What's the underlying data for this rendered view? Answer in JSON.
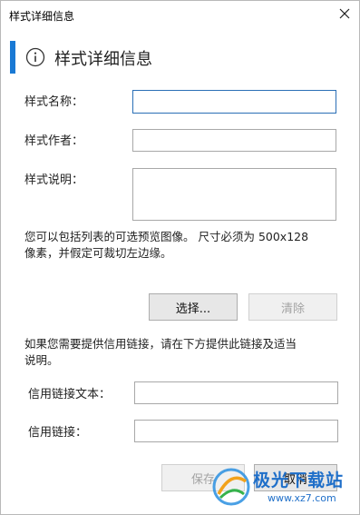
{
  "window": {
    "title": "样式详细信息"
  },
  "header": {
    "title": "样式详细信息",
    "icon": "info-icon",
    "accent_color": "#1979d4"
  },
  "form": {
    "style_name_label": "样式名称：",
    "style_name_value": "",
    "style_author_label": "样式作者：",
    "style_author_value": "",
    "style_description_label": "样式说明：",
    "style_description_value": ""
  },
  "preview": {
    "note_line1": "您可以包括列表的可选预览图像。 尺寸必须为 500x128",
    "note_line2": "像素，并假定可裁切左边缘。",
    "choose_button": "选择...",
    "clear_button": "清除"
  },
  "credit": {
    "note_line1": "如果您需要提供信用链接，请在下方提供此链接及适当",
    "note_line2": "说明。",
    "link_text_label": "信用链接文本：",
    "link_text_value": "",
    "link_label": "信用链接：",
    "link_value": ""
  },
  "footer": {
    "save_button": "保存",
    "cancel_button": "取消"
  },
  "watermark": {
    "text": "极光下载站",
    "url": "www.xz7.com"
  }
}
